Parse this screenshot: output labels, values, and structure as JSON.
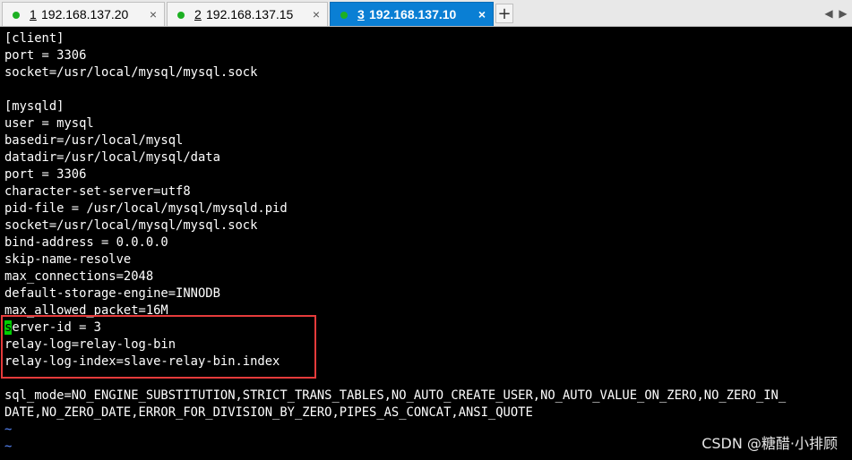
{
  "tabs": [
    {
      "number": "1",
      "host": "192.168.137.20",
      "close": "×",
      "active": false
    },
    {
      "number": "2",
      "host": "192.168.137.15",
      "close": "×",
      "active": false
    },
    {
      "number": "3",
      "host": "192.168.137.10",
      "close": "×",
      "active": true
    }
  ],
  "tabbar": {
    "new_tab": "+",
    "prev": "◀",
    "next": "▶"
  },
  "terminal": {
    "lines": [
      "[client]",
      "port = 3306",
      "socket=/usr/local/mysql/mysql.sock",
      "",
      "[mysqld]",
      "user = mysql",
      "basedir=/usr/local/mysql",
      "datadir=/usr/local/mysql/data",
      "port = 3306",
      "character-set-server=utf8",
      "pid-file = /usr/local/mysql/mysqld.pid",
      "socket=/usr/local/mysql/mysql.sock",
      "bind-address = 0.0.0.0",
      "skip-name-resolve",
      "max_connections=2048",
      "default-storage-engine=INNODB",
      "max_allowed_packet=16M",
      "",
      "relay-log=relay-log-bin",
      "relay-log-index=slave-relay-bin.index",
      "",
      "sql_mode=NO_ENGINE_SUBSTITUTION,STRICT_TRANS_TABLES,NO_AUTO_CREATE_USER,NO_AUTO_VALUE_ON_ZERO,NO_ZERO_IN_",
      "DATE,NO_ZERO_DATE,ERROR_FOR_DIVISION_BY_ZERO,PIPES_AS_CONCAT,ANSI_QUOTE",
      "~",
      "~"
    ],
    "cursor_line": {
      "cursor_char": "s",
      "rest": "erver-id = 3"
    }
  },
  "watermark": "CSDN @糖醋·小排顾",
  "colors": {
    "active_tab": "#0a7fd4",
    "status_dot": "#1db023",
    "cursor": "#00d000",
    "highlight_border": "#e53b3b"
  }
}
